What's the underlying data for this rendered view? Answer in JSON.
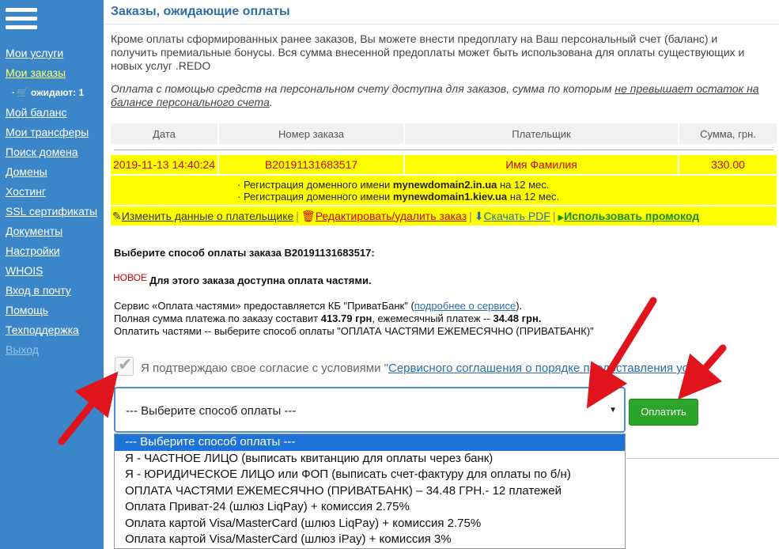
{
  "sidebar": {
    "items": [
      {
        "label": "Мои услуги"
      },
      {
        "label": "Мои заказы"
      },
      {
        "label": "ожидают: 1"
      },
      {
        "label": "Мой баланс"
      },
      {
        "label": "Мои трансферы"
      },
      {
        "label": "Поиск домена"
      },
      {
        "label": "Домены"
      },
      {
        "label": "Хостинг"
      },
      {
        "label": "SSL сертификаты"
      },
      {
        "label": "Документы"
      },
      {
        "label": "Настройки"
      },
      {
        "label": "WHOIS"
      },
      {
        "label": "Вход в почту"
      },
      {
        "label": "Помощь"
      },
      {
        "label": "Техподдержка"
      },
      {
        "label": "Выход"
      }
    ]
  },
  "page": {
    "title": "Заказы, ожидающие оплаты",
    "intro": "Кроме оплаты сформированных ранее заказов, Вы можете внести предоплату на Ваш персональный счет (баланс) и получить премиальные бонусы. Вся сумма внесенной предоплаты может быть использована для оплаты существующих и новых услуг .REDO",
    "note_prefix": "Оплата с помощью средств на персональном счету доступна для заказов, сумма по которым ",
    "note_link": "не превышает остаток на балансе персонального счета",
    "note_suffix": "."
  },
  "orders": {
    "headers": [
      "Дата",
      "Номер заказа",
      "Плательщик",
      "Сумма, грн."
    ],
    "row": {
      "date": "2019-11-13 14:40:24",
      "number": "B20191131683517",
      "payer": "Имя Фамилия",
      "amount": "330.00"
    },
    "details": [
      {
        "prefix": "· Регистрация доменного имени ",
        "domain": "mynewdomain2.in.ua",
        "suffix": " на 12 мес."
      },
      {
        "prefix": "· Регистрация доменного имени ",
        "domain": "mynewdomain1.kiev.ua",
        "suffix": " на 12 мес."
      }
    ],
    "actions": {
      "edit": "Изменить данные о плательщике",
      "delete": "Редактировать/удалить заказ",
      "pdf": "Скачать PDF",
      "promo": "Использовать промокод"
    }
  },
  "payment": {
    "choose_title": "Выберите способ оплаты заказа B20191131683517:",
    "new_badge": "НОВОЕ",
    "installments_title": "Для этого заказа доступна оплата частями.",
    "service_line1_prefix": "Сервис «Оплата частями» предоставляется КБ \"ПриватБанк\" (",
    "service_line1_link": "подробнее о сервисе",
    "service_line1_suffix": ").",
    "service_line2_prefix": "Полная сумма платежа по заказу составит ",
    "service_line2_total": "413.79 грн",
    "service_line2_mid": ", ежемесячный платеж -- ",
    "service_line2_monthly": "34.48 грн.",
    "service_line3": "Оплатить частями -- выберите способ оплаты \"ОПЛАТА ЧАСТЯМИ ЕЖЕМЕСЯЧНО (ПРИВАТБАНК)\"",
    "consent_prefix": "Я подтверждаю свое согласие с условиями \"",
    "consent_link": "Сервисного соглашения о порядке предоставления услуг",
    "consent_suffix": "\"",
    "consent_checked": true,
    "select_value": "--- Выберите способ оплаты ---",
    "pay_button": "Оплатить",
    "options": [
      "--- Выберите способ оплаты ---",
      "Я - ЧАСТНОЕ ЛИЦО (выписать квитанцию для оплаты через банк)",
      "Я - ЮРИДИЧЕСКОЕ ЛИЦО или ФОП (выписать счет-фактуру для оплаты по б/н)",
      "ОПЛАТА ЧАСТЯМИ ЕЖЕМЕСЯЧНО (ПРИВАТБАНК) – 34.48 ГРН.- 12 платежей",
      "Оплата Приват-24 (шлюз LiqPay) + комиссия 2.75%",
      "Оплата картой Visa/MasterCard (шлюз LiqPay) + комиссия 2.75%",
      "Оплата картой Visa/MasterCard (шлюз iPay) + комиссия 3%"
    ]
  },
  "colors": {
    "sidebar": "#3b86c9",
    "highlight": "#ffff00",
    "accent_red": "#cc0000",
    "link": "#2d6ea8",
    "pay_green": "#2aa52a",
    "annotation_arrow": "#e0141c"
  }
}
